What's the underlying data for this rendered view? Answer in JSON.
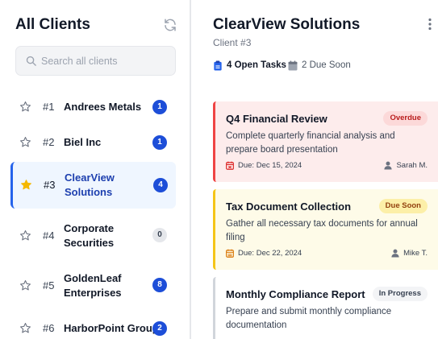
{
  "sidebar": {
    "title": "All Clients",
    "search_placeholder": "Search all clients",
    "clients": [
      {
        "num": "#1",
        "name": "Andrees Metals",
        "count": "1",
        "starred": false,
        "active": false
      },
      {
        "num": "#2",
        "name": "Biel Inc",
        "count": "1",
        "starred": false,
        "active": false
      },
      {
        "num": "#3",
        "name": "ClearView Solutions",
        "count": "4",
        "starred": true,
        "active": true
      },
      {
        "num": "#4",
        "name": "Corporate Securities",
        "count": "0",
        "starred": false,
        "active": false
      },
      {
        "num": "#5",
        "name": "GoldenLeaf Enterprises",
        "count": "8",
        "starred": false,
        "active": false
      },
      {
        "num": "#6",
        "name": "HarborPoint Group",
        "count": "2",
        "starred": false,
        "active": false
      }
    ]
  },
  "main": {
    "title": "ClearView Solutions",
    "subtitle": "Client #3",
    "open_tasks": "4 Open Tasks",
    "due_soon": "2 Due Soon",
    "tasks": [
      {
        "title": "Q4 Financial Review",
        "status": "Overdue",
        "description": "Complete quarterly financial analysis and prepare board presentation",
        "due": "Due: Dec 15, 2024",
        "assignee": "Sarah M."
      },
      {
        "title": "Tax Document Collection",
        "status": "Due Soon",
        "description": "Gather all necessary tax documents for annual filing",
        "due": "Due: Dec 22, 2024",
        "assignee": "Mike T."
      },
      {
        "title": "Monthly Compliance Report",
        "status": "In Progress",
        "description": "Prepare and submit monthly compliance documentation"
      }
    ]
  },
  "colors": {
    "accent": "#2563eb",
    "overdue_bg": "#fdecec",
    "overdue_border": "#ef4444",
    "due_soon_bg": "#fefbe8",
    "due_soon_border": "#f5c518",
    "in_progress_border": "#d1d5db",
    "star_active": "#f5b800"
  },
  "icons": [
    "refresh-icon",
    "search-icon",
    "star-icon",
    "star-filled-icon",
    "clipboard-icon",
    "calendar-icon",
    "user-icon",
    "kebab-icon"
  ]
}
